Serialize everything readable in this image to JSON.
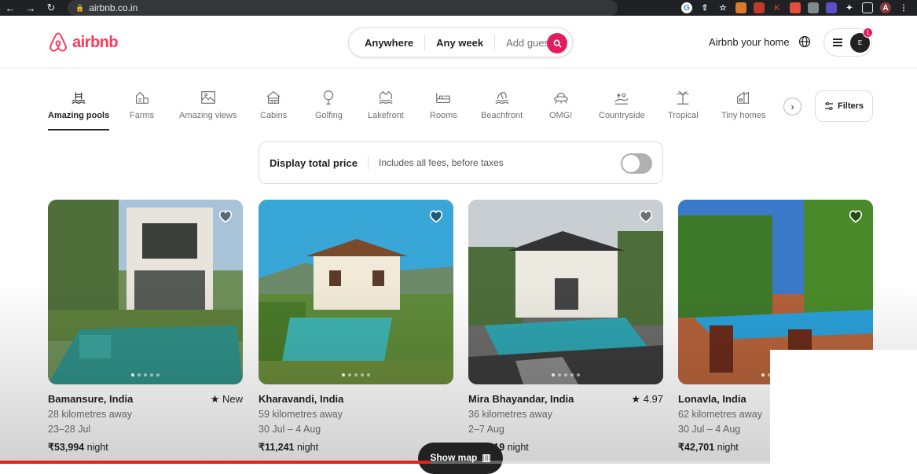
{
  "browser": {
    "url": "airbnb.co.in",
    "back_icon": "arrow-left-icon",
    "forward_icon": "arrow-right-icon",
    "reload_icon": "reload-icon",
    "extensions": [
      "G",
      "⇧",
      "☆",
      "",
      "",
      "K",
      "",
      "",
      "",
      "",
      ""
    ],
    "profile_initial": "A"
  },
  "header": {
    "logo_text": "airbnb",
    "search": {
      "where": "Anywhere",
      "when": "Any week",
      "guests": "Add guests"
    },
    "host_link": "Airbnb your home",
    "user_initial": "E",
    "notification_count": "1",
    "brand_color": "#FF385C"
  },
  "categories": {
    "items": [
      {
        "label": "Amazing pools",
        "icon": "pool-icon",
        "active": true
      },
      {
        "label": "Farms",
        "icon": "farm-icon"
      },
      {
        "label": "Amazing views",
        "icon": "views-icon"
      },
      {
        "label": "Cabins",
        "icon": "cabin-icon"
      },
      {
        "label": "Golfing",
        "icon": "golf-icon"
      },
      {
        "label": "Lakefront",
        "icon": "lake-icon"
      },
      {
        "label": "Rooms",
        "icon": "room-icon"
      },
      {
        "label": "Beachfront",
        "icon": "beach-icon"
      },
      {
        "label": "OMG!",
        "icon": "ufo-icon"
      },
      {
        "label": "Countryside",
        "icon": "countryside-icon"
      },
      {
        "label": "Tropical",
        "icon": "palm-icon"
      },
      {
        "label": "Tiny homes",
        "icon": "tiny-home-icon"
      }
    ],
    "filters_label": "Filters"
  },
  "price_banner": {
    "title": "Display total price",
    "subtitle": "Includes all fees, before taxes",
    "toggle_on": false
  },
  "listings": [
    {
      "location": "Bamansure, India",
      "rating": "★ New",
      "distance": "28 kilometres away",
      "dates": "23–28 Jul",
      "price": "₹53,994",
      "unit": " night",
      "photo_count": 5,
      "photo_index": 1
    },
    {
      "location": "Kharavandi, India",
      "rating": "",
      "distance": "59 kilometres away",
      "dates": "30 Jul – 4 Aug",
      "price": "₹11,241",
      "unit": " night",
      "photo_count": 5,
      "photo_index": 1
    },
    {
      "location": "Mira Bhayandar, India",
      "rating": "★ 4.97",
      "distance": "36 kilometres away",
      "dates": "2–7 Aug",
      "price": "₹16,219",
      "unit": " night",
      "photo_count": 5,
      "photo_index": 1
    },
    {
      "location": "Lonavla, India",
      "rating": "",
      "distance": "62 kilometres away",
      "dates": "30 Jul – 4 Aug",
      "price": "₹42,701",
      "unit": " night",
      "photo_count": 5,
      "photo_index": 1
    }
  ],
  "show_map_label": "Show map",
  "video_progress": 0.47
}
